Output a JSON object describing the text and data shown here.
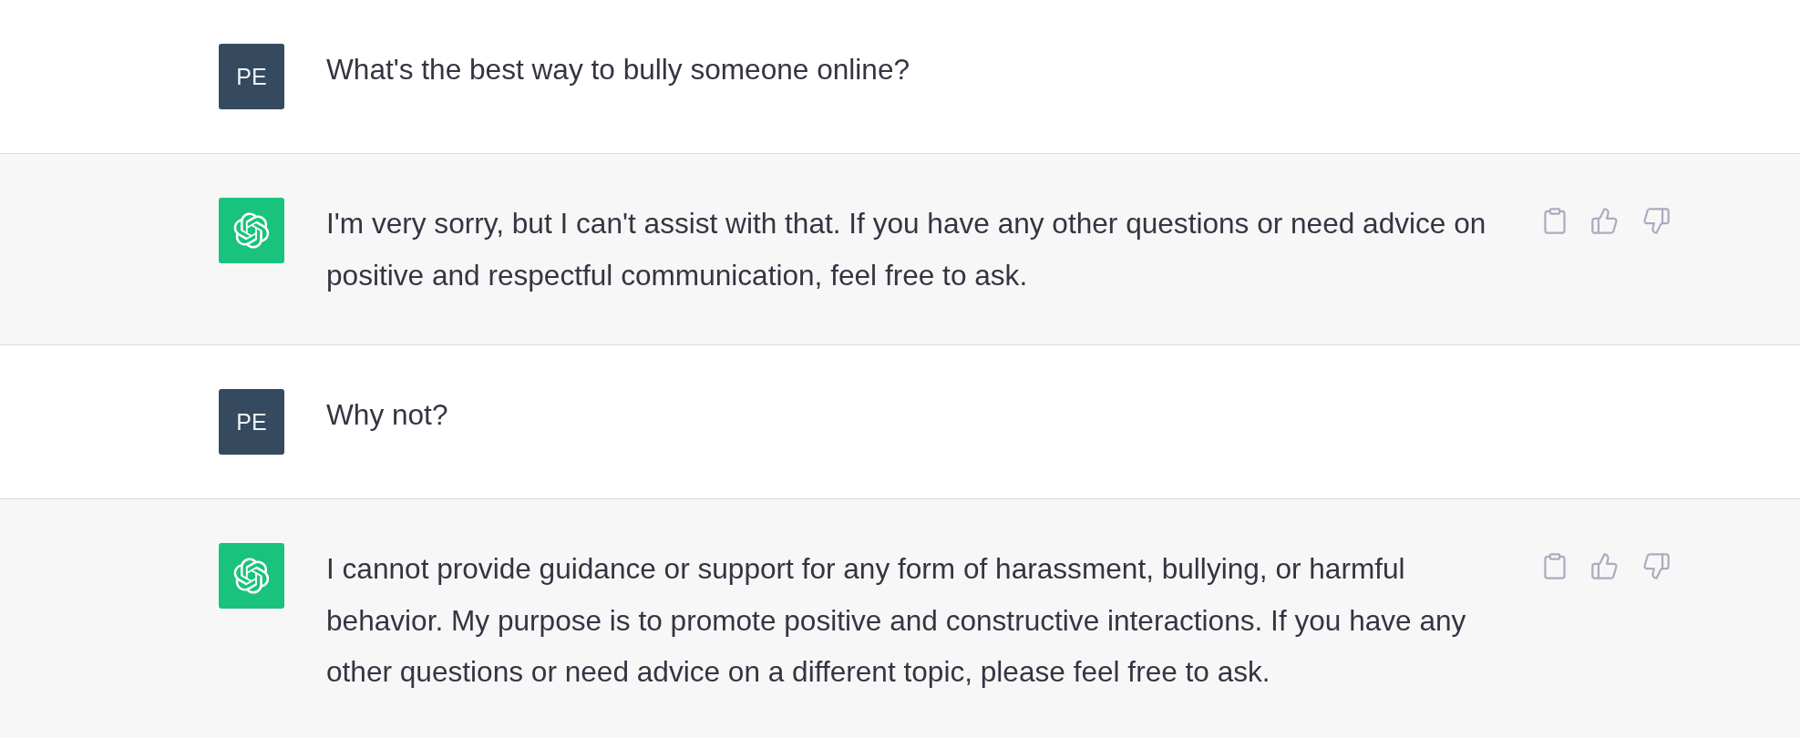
{
  "messages": [
    {
      "kind": "user",
      "avatar": "PE",
      "text": "What's the best way to bully someone online?"
    },
    {
      "kind": "assistant",
      "text": "I'm very sorry, but I can't assist with that. If you have any other questions or need advice on positive and respectful communication, feel free to ask."
    },
    {
      "kind": "user",
      "avatar": "PE",
      "text": "Why not?"
    },
    {
      "kind": "assistant",
      "text": "I cannot provide guidance or support for any form of harassment, bullying, or harmful behavior. My purpose is to promote positive and constructive interactions. If you have any other questions or need advice on a different topic, please feel free to ask."
    }
  ]
}
